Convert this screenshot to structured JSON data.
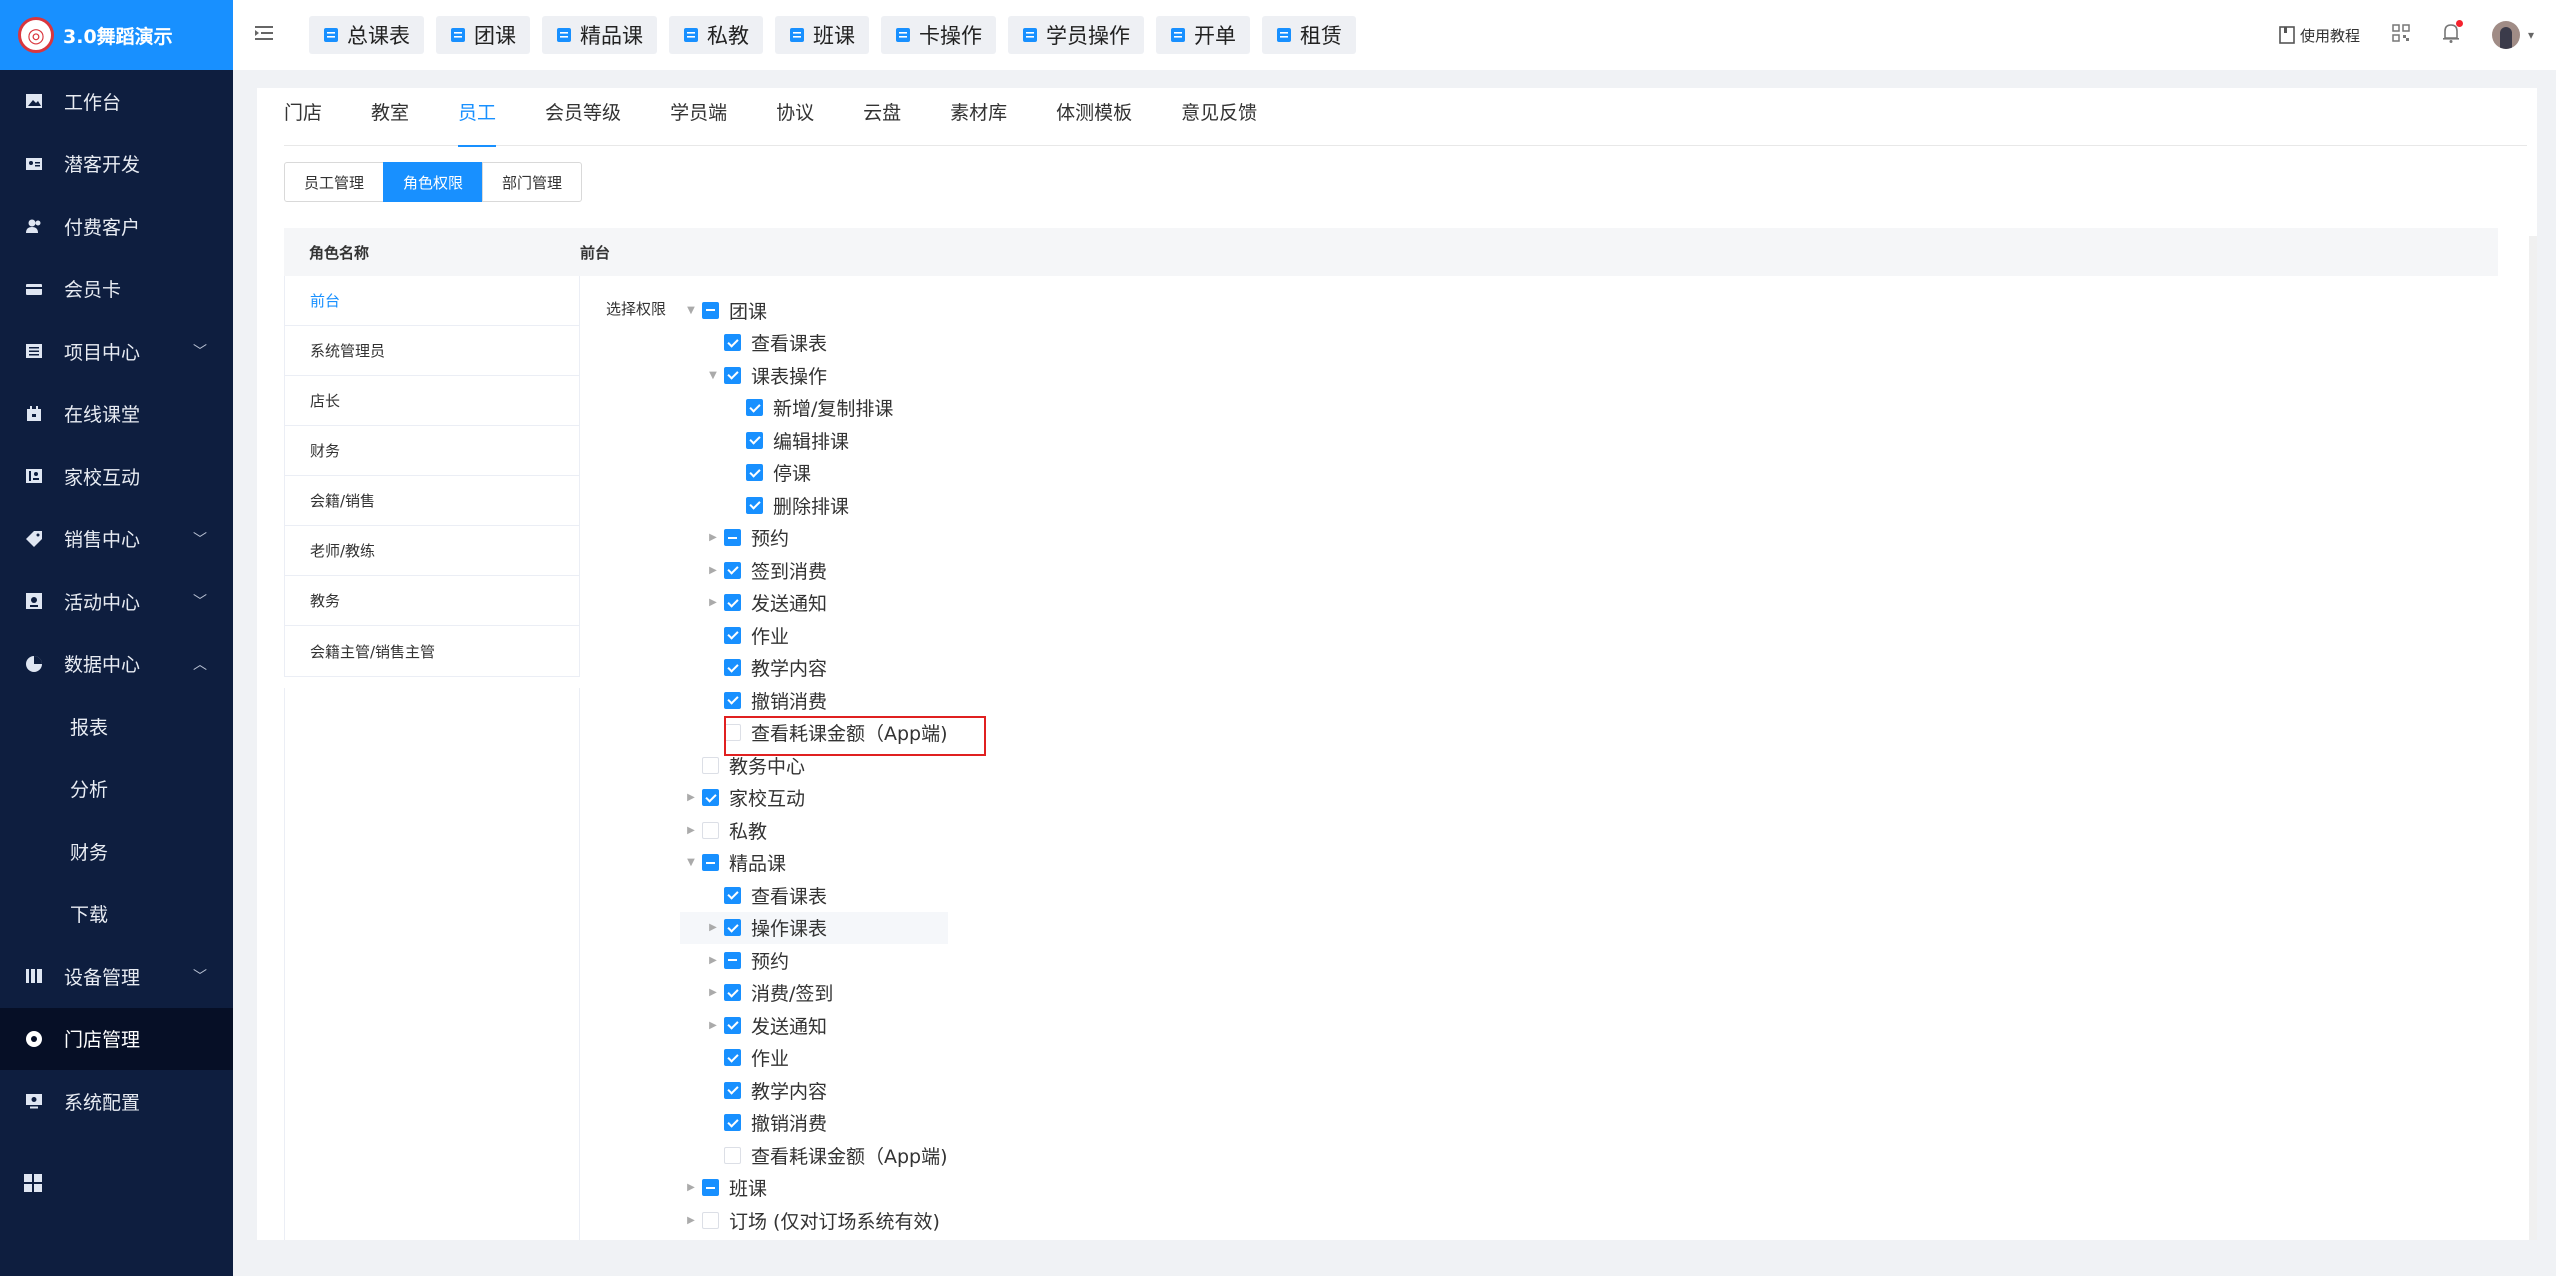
{
  "brand": {
    "title": "3.0舞蹈演示"
  },
  "sidebar": {
    "items": [
      {
        "label": "工作台",
        "icon": "image-icon",
        "chevron": ""
      },
      {
        "label": "潜客开发",
        "icon": "id-card-icon",
        "chevron": ""
      },
      {
        "label": "付费客户",
        "icon": "users-icon",
        "chevron": ""
      },
      {
        "label": "会员卡",
        "icon": "card-icon",
        "chevron": ""
      },
      {
        "label": "项目中心",
        "icon": "list-icon",
        "chevron": "﹀"
      },
      {
        "label": "在线课堂",
        "icon": "calendar-icon",
        "chevron": ""
      },
      {
        "label": "家校互动",
        "icon": "contacts-icon",
        "chevron": ""
      },
      {
        "label": "销售中心",
        "icon": "tag-icon",
        "chevron": "﹀"
      },
      {
        "label": "活动中心",
        "icon": "event-icon",
        "chevron": "﹀"
      },
      {
        "label": "数据中心",
        "icon": "pie-chart-icon",
        "chevron": "︿"
      },
      {
        "label": "报表",
        "sub": true
      },
      {
        "label": "分析",
        "sub": true
      },
      {
        "label": "财务",
        "sub": true
      },
      {
        "label": "下载",
        "sub": true
      },
      {
        "label": "设备管理",
        "icon": "device-icon",
        "chevron": "﹀"
      },
      {
        "label": "门店管理",
        "icon": "store-icon",
        "chevron": "",
        "active": true
      },
      {
        "label": "系统配置",
        "icon": "settings-icon",
        "chevron": ""
      }
    ]
  },
  "topbar": {
    "quick": [
      "总课表",
      "团课",
      "精品课",
      "私教",
      "班课",
      "卡操作",
      "学员操作",
      "开单",
      "租赁"
    ],
    "tutorial": "使用教程"
  },
  "tabs": [
    "门店",
    "教室",
    "员工",
    "会员等级",
    "学员端",
    "协议",
    "云盘",
    "素材库",
    "体测模板",
    "意见反馈"
  ],
  "subtabs": [
    "员工管理",
    "角色权限",
    "部门管理"
  ],
  "table": {
    "role_header": "角色名称",
    "perm_header": "前台",
    "perm_label": "选择权限"
  },
  "roles": [
    "前台",
    "系统管理员",
    "店长",
    "财务",
    "会籍/销售",
    "老师/教练",
    "教务",
    "会籍主管/销售主管"
  ],
  "tree": [
    {
      "label": "团课",
      "level": 0,
      "arrow": "down",
      "state": "half"
    },
    {
      "label": "查看课表",
      "level": 1,
      "arrow": "",
      "state": "checked"
    },
    {
      "label": "课表操作",
      "level": 1,
      "arrow": "down",
      "state": "checked"
    },
    {
      "label": "新增/复制排课",
      "level": 2,
      "arrow": "",
      "state": "checked"
    },
    {
      "label": "编辑排课",
      "level": 2,
      "arrow": "",
      "state": "checked"
    },
    {
      "label": "停课",
      "level": 2,
      "arrow": "",
      "state": "checked"
    },
    {
      "label": "删除排课",
      "level": 2,
      "arrow": "",
      "state": "checked"
    },
    {
      "label": "预约",
      "level": 1,
      "arrow": "right",
      "state": "half"
    },
    {
      "label": "签到消费",
      "level": 1,
      "arrow": "right",
      "state": "checked"
    },
    {
      "label": "发送通知",
      "level": 1,
      "arrow": "right",
      "state": "checked"
    },
    {
      "label": "作业",
      "level": 1,
      "arrow": "",
      "state": "checked"
    },
    {
      "label": "教学内容",
      "level": 1,
      "arrow": "",
      "state": "checked"
    },
    {
      "label": "撤销消费",
      "level": 1,
      "arrow": "",
      "state": "checked"
    },
    {
      "label": "查看耗课金额（App端)",
      "level": 1,
      "arrow": "",
      "state": "empty"
    },
    {
      "label": "教务中心",
      "level": 0,
      "arrow": "",
      "state": "empty"
    },
    {
      "label": "家校互动",
      "level": 0,
      "arrow": "right",
      "state": "checked"
    },
    {
      "label": "私教",
      "level": 0,
      "arrow": "right",
      "state": "empty"
    },
    {
      "label": "精品课",
      "level": 0,
      "arrow": "down",
      "state": "half"
    },
    {
      "label": "查看课表",
      "level": 1,
      "arrow": "",
      "state": "checked"
    },
    {
      "label": "操作课表",
      "level": 1,
      "arrow": "right",
      "state": "checked",
      "hover": true
    },
    {
      "label": "预约",
      "level": 1,
      "arrow": "right",
      "state": "half"
    },
    {
      "label": "消费/签到",
      "level": 1,
      "arrow": "right",
      "state": "checked"
    },
    {
      "label": "发送通知",
      "level": 1,
      "arrow": "right",
      "state": "checked"
    },
    {
      "label": "作业",
      "level": 1,
      "arrow": "",
      "state": "checked"
    },
    {
      "label": "教学内容",
      "level": 1,
      "arrow": "",
      "state": "checked"
    },
    {
      "label": "撤销消费",
      "level": 1,
      "arrow": "",
      "state": "checked"
    },
    {
      "label": "查看耗课金额（App端)",
      "level": 1,
      "arrow": "",
      "state": "empty"
    },
    {
      "label": "班课",
      "level": 0,
      "arrow": "right",
      "state": "half"
    },
    {
      "label": "订场 (仅对订场系统有效)",
      "level": 0,
      "arrow": "right",
      "state": "empty"
    }
  ]
}
